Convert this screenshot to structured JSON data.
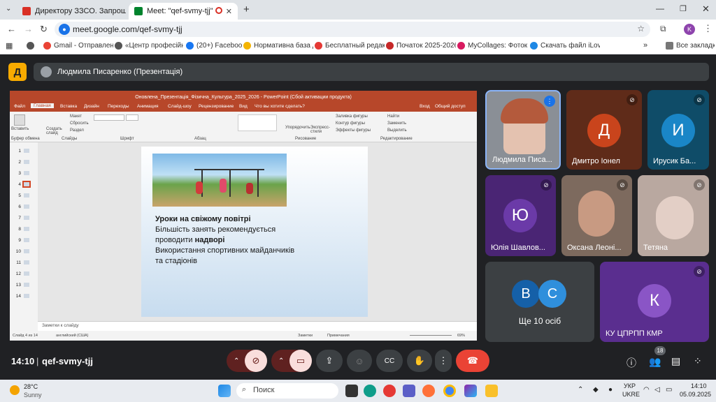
{
  "browser": {
    "tabs": [
      {
        "label": "Директору ЗЗСО. Запрошення",
        "favicon_color": "#d93025"
      },
      {
        "label": "Meet: \"qef-svmy-tjj\"",
        "favicon_color": "#00832d"
      }
    ],
    "new_tab": "+",
    "url": "meet.google.com/qef-svmy-tjj",
    "profile_initial": "K",
    "bookmarks": [
      {
        "label": "Gmail - Отправлен...",
        "color": "#ea4335"
      },
      {
        "label": "«Центр професійн...",
        "color": "#555555"
      },
      {
        "label": "(20+) Facebook",
        "color": "#1877f2"
      },
      {
        "label": "Нормативна база д...",
        "color": "#f4b400"
      },
      {
        "label": "Бесплатный редакт...",
        "color": "#e53935"
      },
      {
        "label": "Початок 2025-2026...",
        "color": "#c62828"
      },
      {
        "label": "MyCollages: Фоток...",
        "color": "#d81b60"
      },
      {
        "label": "Скачать файл iLov...",
        "color": "#1e88e5"
      }
    ],
    "all_bookmarks": "Все закладки"
  },
  "meet": {
    "logo": "Д",
    "presenter_label": "Людмила Писаренко (Презентація)",
    "time": "14:10",
    "meeting_code": "qef-svmy-tjj",
    "participants_count": "18",
    "tiles": [
      {
        "name": "Людмила Писа...",
        "color": "#8a8f96",
        "speaking": true
      },
      {
        "name": "Дмитро Іонел",
        "initial": "Д",
        "bg": "#5f2b19",
        "avatar": "#c9441c"
      },
      {
        "name": "Ирусик Ба...",
        "initial": "И",
        "bg": "#0f4c68",
        "avatar": "#1a86c7"
      },
      {
        "name": "Юлія Шавлов...",
        "initial": "Ю",
        "bg": "#4a2574",
        "avatar": "#6b3aa8"
      },
      {
        "name": "Оксана Леоні...",
        "color": "#7d6a5e"
      },
      {
        "name": "Тетяна",
        "color": "#b9a8a0"
      },
      {
        "name": "Ще 10 осіб",
        "initials": [
          "В",
          "С"
        ]
      },
      {
        "name": "КУ ЦПРПП КМР",
        "initial": "К",
        "bg": "#5a2e8f",
        "avatar": "#8a55c6"
      }
    ]
  },
  "ppt": {
    "title": "Оновлена_Презентація_Фізична_Культура_2025_2026 - PowerPoint (Сбой активации продукта)",
    "tabs": [
      "Файл",
      "Главная",
      "Вставка",
      "Дизайн",
      "Переходы",
      "Анимация",
      "Слайд-шоу",
      "Рецензирование",
      "Вид",
      "Что вы хотите сделать?"
    ],
    "right_tabs": [
      "Вход",
      "Общий доступ"
    ],
    "ribbon": {
      "paste": "Вставить",
      "clipboard": "Буфер обмена",
      "new_slide": "Создать слайд",
      "layout": "Макет",
      "reset": "Сбросить",
      "section": "Раздел",
      "slides": "Слайды",
      "font": "Шрифт",
      "paragraph": "Абзац",
      "arrange": "Упорядочить",
      "quick_styles": "Экспресс-стили",
      "fill": "Заливка фигуры",
      "outline": "Контур фигуры",
      "effects": "Эффекты фигуры",
      "drawing": "Рисование",
      "find": "Найти",
      "replace": "Заменить",
      "select": "Выделить",
      "editing": "Редактирование"
    },
    "slide_numbers": [
      "1",
      "2",
      "3",
      "4",
      "5",
      "6",
      "7",
      "8",
      "9",
      "10",
      "11",
      "12",
      "13",
      "14"
    ],
    "current_slide": 4,
    "slide": {
      "heading": "Уроки на свіжому повітрі",
      "line1": "Більшість занять рекомендується",
      "line2a": "проводити ",
      "line2b": "надворі",
      "line3": "Використання спортивних майданчиків",
      "line4": "та стадіонів"
    },
    "notes": "Заметки к слайду",
    "status_slide": "Слайд 4 из 14",
    "status_lang": "английский (США)",
    "status_notes": "Заметки",
    "status_comments": "Примечания",
    "zoom": "69%"
  },
  "taskbar": {
    "temp": "28°C",
    "weather": "Sunny",
    "search": "Поиск",
    "lang1": "УКР",
    "lang2": "UKRE",
    "time": "14:10",
    "date": "05.09.2025"
  }
}
